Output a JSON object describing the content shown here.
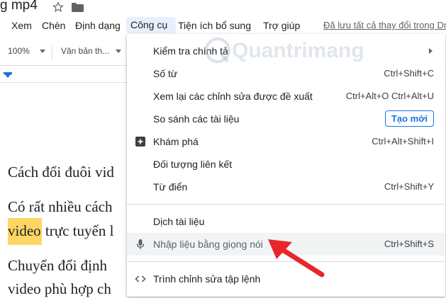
{
  "doc": {
    "title": "g mp4",
    "lines": [
      "Cách đổi đuôi vid",
      "Có rất nhiều cách",
      "trực tuyến l",
      "Chuyển đổi định",
      "video phù hợp ch"
    ],
    "highlight": "video"
  },
  "menubar": {
    "items": [
      "Xem",
      "Chèn",
      "Định dạng",
      "Công cụ",
      "Tiện ích bổ sung",
      "Trợ giúp"
    ],
    "saved_text": "Đã lưu tất cả thay đổi trong Dr"
  },
  "toolbar": {
    "zoom": "100%",
    "style": "Văn bản th..."
  },
  "menu": {
    "items": [
      {
        "label": "Kiểm tra chính tả",
        "shortcut": "",
        "submenu": true
      },
      {
        "label": "Số từ",
        "shortcut": "Ctrl+Shift+C"
      },
      {
        "label": "Xem lại các chỉnh sửa được đề xuất",
        "shortcut": "Ctrl+Alt+O Ctrl+Alt+U"
      },
      {
        "label": "So sánh các tài liệu",
        "button": "Tạo mới"
      },
      {
        "label": "Khám phá",
        "shortcut": "Ctrl+Alt+Shift+I",
        "icon": "explore-icon"
      },
      {
        "label": "Đối tượng liên kết",
        "shortcut": ""
      },
      {
        "label": "Từ điển",
        "shortcut": "Ctrl+Shift+Y"
      },
      {
        "label": "Dịch tài liệu",
        "shortcut": ""
      },
      {
        "label": "Nhập liệu bằng giọng nói",
        "shortcut": "Ctrl+Shift+S",
        "icon": "microphone-icon"
      },
      {
        "label": "Trình chỉnh sửa tập lệnh",
        "shortcut": "",
        "icon": "code-icon"
      }
    ]
  },
  "watermark": "Quantrimang",
  "colors": {
    "accent": "#1a73e8",
    "highlight": "#fdd663",
    "arrow": "#e8262b"
  }
}
